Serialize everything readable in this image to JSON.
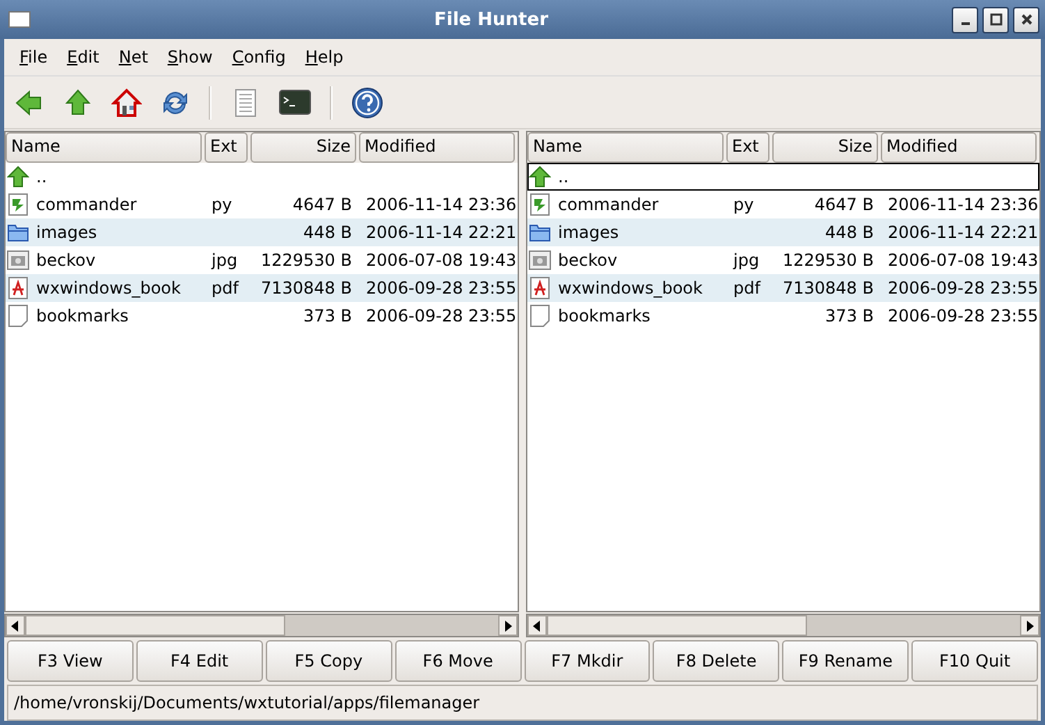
{
  "window": {
    "title": "File Hunter"
  },
  "menu": [
    "File",
    "Edit",
    "Net",
    "Show",
    "Config",
    "Help"
  ],
  "toolbar": [
    {
      "kind": "back"
    },
    {
      "kind": "up"
    },
    {
      "kind": "home"
    },
    {
      "kind": "refresh"
    },
    {
      "kind": "separator"
    },
    {
      "kind": "document"
    },
    {
      "kind": "terminal"
    },
    {
      "kind": "separator"
    },
    {
      "kind": "help"
    }
  ],
  "panes": [
    {
      "columns": [
        "Name",
        "Ext",
        "Size",
        "Modified"
      ],
      "rows": [
        {
          "kind": "up",
          "name": "..",
          "selected": false
        },
        {
          "kind": "script",
          "name": "commander",
          "ext": "py",
          "size": "4647 B",
          "modified": "2006-11-14 23:36",
          "selected": false
        },
        {
          "kind": "folder",
          "name": "images",
          "size": "448 B",
          "modified": "2006-11-14 22:21",
          "selected": false
        },
        {
          "kind": "image",
          "name": "beckov",
          "ext": "jpg",
          "size": "1229530 B",
          "modified": "2006-07-08 19:43",
          "selected": false
        },
        {
          "kind": "pdf",
          "name": "wxwindows_book",
          "ext": "pdf",
          "size": "7130848 B",
          "modified": "2006-09-28 23:55",
          "selected": false
        },
        {
          "kind": "text",
          "name": "bookmarks",
          "size": "373 B",
          "modified": "2006-09-28 23:55",
          "selected": false
        }
      ]
    },
    {
      "columns": [
        "Name",
        "Ext",
        "Size",
        "Modified"
      ],
      "rows": [
        {
          "kind": "up",
          "name": "..",
          "selected": true
        },
        {
          "kind": "script",
          "name": "commander",
          "ext": "py",
          "size": "4647 B",
          "modified": "2006-11-14 23:36",
          "selected": false
        },
        {
          "kind": "folder",
          "name": "images",
          "size": "448 B",
          "modified": "2006-11-14 22:21",
          "selected": false
        },
        {
          "kind": "image",
          "name": "beckov",
          "ext": "jpg",
          "size": "1229530 B",
          "modified": "2006-07-08 19:43",
          "selected": false
        },
        {
          "kind": "pdf",
          "name": "wxwindows_book",
          "ext": "pdf",
          "size": "7130848 B",
          "modified": "2006-09-28 23:55",
          "selected": false
        },
        {
          "kind": "text",
          "name": "bookmarks",
          "size": "373 B",
          "modified": "2006-09-28 23:55",
          "selected": false
        }
      ]
    }
  ],
  "buttons": [
    "F3 View",
    "F4 Edit",
    "F5 Copy",
    "F6 Move",
    "F7 Mkdir",
    "F8 Delete",
    "F9 Rename",
    "F10 Quit"
  ],
  "status_bar": "/home/vronskij/Documents/wxtutorial/apps/filemanager"
}
